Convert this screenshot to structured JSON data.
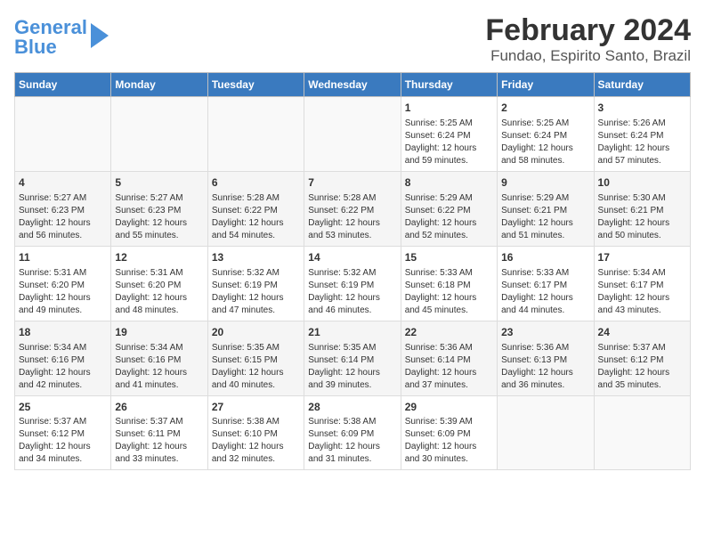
{
  "header": {
    "logo_general": "General",
    "logo_blue": "Blue",
    "title": "February 2024",
    "subtitle": "Fundao, Espirito Santo, Brazil"
  },
  "columns": [
    "Sunday",
    "Monday",
    "Tuesday",
    "Wednesday",
    "Thursday",
    "Friday",
    "Saturday"
  ],
  "weeks": [
    [
      {
        "day": "",
        "info": ""
      },
      {
        "day": "",
        "info": ""
      },
      {
        "day": "",
        "info": ""
      },
      {
        "day": "",
        "info": ""
      },
      {
        "day": "1",
        "info": "Sunrise: 5:25 AM\nSunset: 6:24 PM\nDaylight: 12 hours and 59 minutes."
      },
      {
        "day": "2",
        "info": "Sunrise: 5:25 AM\nSunset: 6:24 PM\nDaylight: 12 hours and 58 minutes."
      },
      {
        "day": "3",
        "info": "Sunrise: 5:26 AM\nSunset: 6:24 PM\nDaylight: 12 hours and 57 minutes."
      }
    ],
    [
      {
        "day": "4",
        "info": "Sunrise: 5:27 AM\nSunset: 6:23 PM\nDaylight: 12 hours and 56 minutes."
      },
      {
        "day": "5",
        "info": "Sunrise: 5:27 AM\nSunset: 6:23 PM\nDaylight: 12 hours and 55 minutes."
      },
      {
        "day": "6",
        "info": "Sunrise: 5:28 AM\nSunset: 6:22 PM\nDaylight: 12 hours and 54 minutes."
      },
      {
        "day": "7",
        "info": "Sunrise: 5:28 AM\nSunset: 6:22 PM\nDaylight: 12 hours and 53 minutes."
      },
      {
        "day": "8",
        "info": "Sunrise: 5:29 AM\nSunset: 6:22 PM\nDaylight: 12 hours and 52 minutes."
      },
      {
        "day": "9",
        "info": "Sunrise: 5:29 AM\nSunset: 6:21 PM\nDaylight: 12 hours and 51 minutes."
      },
      {
        "day": "10",
        "info": "Sunrise: 5:30 AM\nSunset: 6:21 PM\nDaylight: 12 hours and 50 minutes."
      }
    ],
    [
      {
        "day": "11",
        "info": "Sunrise: 5:31 AM\nSunset: 6:20 PM\nDaylight: 12 hours and 49 minutes."
      },
      {
        "day": "12",
        "info": "Sunrise: 5:31 AM\nSunset: 6:20 PM\nDaylight: 12 hours and 48 minutes."
      },
      {
        "day": "13",
        "info": "Sunrise: 5:32 AM\nSunset: 6:19 PM\nDaylight: 12 hours and 47 minutes."
      },
      {
        "day": "14",
        "info": "Sunrise: 5:32 AM\nSunset: 6:19 PM\nDaylight: 12 hours and 46 minutes."
      },
      {
        "day": "15",
        "info": "Sunrise: 5:33 AM\nSunset: 6:18 PM\nDaylight: 12 hours and 45 minutes."
      },
      {
        "day": "16",
        "info": "Sunrise: 5:33 AM\nSunset: 6:17 PM\nDaylight: 12 hours and 44 minutes."
      },
      {
        "day": "17",
        "info": "Sunrise: 5:34 AM\nSunset: 6:17 PM\nDaylight: 12 hours and 43 minutes."
      }
    ],
    [
      {
        "day": "18",
        "info": "Sunrise: 5:34 AM\nSunset: 6:16 PM\nDaylight: 12 hours and 42 minutes."
      },
      {
        "day": "19",
        "info": "Sunrise: 5:34 AM\nSunset: 6:16 PM\nDaylight: 12 hours and 41 minutes."
      },
      {
        "day": "20",
        "info": "Sunrise: 5:35 AM\nSunset: 6:15 PM\nDaylight: 12 hours and 40 minutes."
      },
      {
        "day": "21",
        "info": "Sunrise: 5:35 AM\nSunset: 6:14 PM\nDaylight: 12 hours and 39 minutes."
      },
      {
        "day": "22",
        "info": "Sunrise: 5:36 AM\nSunset: 6:14 PM\nDaylight: 12 hours and 37 minutes."
      },
      {
        "day": "23",
        "info": "Sunrise: 5:36 AM\nSunset: 6:13 PM\nDaylight: 12 hours and 36 minutes."
      },
      {
        "day": "24",
        "info": "Sunrise: 5:37 AM\nSunset: 6:12 PM\nDaylight: 12 hours and 35 minutes."
      }
    ],
    [
      {
        "day": "25",
        "info": "Sunrise: 5:37 AM\nSunset: 6:12 PM\nDaylight: 12 hours and 34 minutes."
      },
      {
        "day": "26",
        "info": "Sunrise: 5:37 AM\nSunset: 6:11 PM\nDaylight: 12 hours and 33 minutes."
      },
      {
        "day": "27",
        "info": "Sunrise: 5:38 AM\nSunset: 6:10 PM\nDaylight: 12 hours and 32 minutes."
      },
      {
        "day": "28",
        "info": "Sunrise: 5:38 AM\nSunset: 6:09 PM\nDaylight: 12 hours and 31 minutes."
      },
      {
        "day": "29",
        "info": "Sunrise: 5:39 AM\nSunset: 6:09 PM\nDaylight: 12 hours and 30 minutes."
      },
      {
        "day": "",
        "info": ""
      },
      {
        "day": "",
        "info": ""
      }
    ]
  ]
}
